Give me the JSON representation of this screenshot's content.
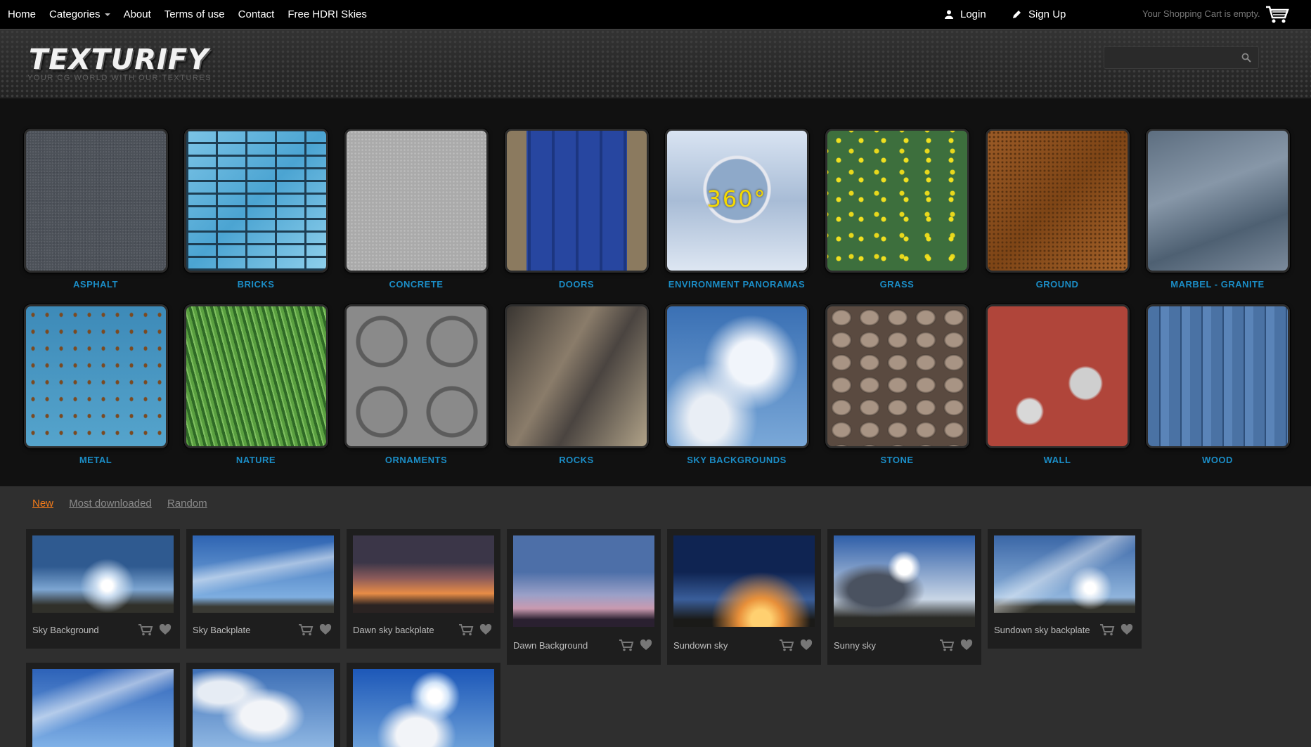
{
  "nav": {
    "items": [
      {
        "label": "Home",
        "active": true
      },
      {
        "label": "Categories",
        "dropdown": true
      },
      {
        "label": "About"
      },
      {
        "label": "Terms of use"
      },
      {
        "label": "Contact"
      },
      {
        "label": "Free HDRI Skies"
      }
    ],
    "login": "Login",
    "signup": "Sign Up",
    "cart_text": "Your Shopping Cart is empty."
  },
  "header": {
    "logo": "TEXTURIFY",
    "tagline": "YOUR CG WORLD WITH OUR TEXTURES",
    "search_placeholder": ""
  },
  "categories": [
    {
      "label": "ASPHALT"
    },
    {
      "label": "BRICKS"
    },
    {
      "label": "CONCRETE"
    },
    {
      "label": "DOORS"
    },
    {
      "label": "ENVIRONMENT PANORAMAS",
      "overlay": "360°"
    },
    {
      "label": "GRASS"
    },
    {
      "label": "GROUND"
    },
    {
      "label": "MARBEL - GRANITE"
    },
    {
      "label": "METAL"
    },
    {
      "label": "NATURE"
    },
    {
      "label": "ORNAMENTS"
    },
    {
      "label": "ROCKS"
    },
    {
      "label": "SKY BACKGROUNDS"
    },
    {
      "label": "STONE"
    },
    {
      "label": "WALL"
    },
    {
      "label": "WOOD"
    }
  ],
  "tabs": [
    {
      "label": "New",
      "active": true
    },
    {
      "label": "Most downloaded"
    },
    {
      "label": "Random"
    }
  ],
  "products": [
    {
      "title": "Sky Background"
    },
    {
      "title": "Sky Backplate"
    },
    {
      "title": "Dawn sky backplate"
    },
    {
      "title": "Dawn Background"
    },
    {
      "title": "Sundown sky"
    },
    {
      "title": "Sunny sky"
    },
    {
      "title": "Sundown sky backplate"
    },
    {
      "title": ""
    },
    {
      "title": ""
    },
    {
      "title": ""
    }
  ],
  "colors": {
    "accent_blue": "#1b8dc6",
    "tab_active": "#f07a1a",
    "background": "#2f2f2f"
  }
}
